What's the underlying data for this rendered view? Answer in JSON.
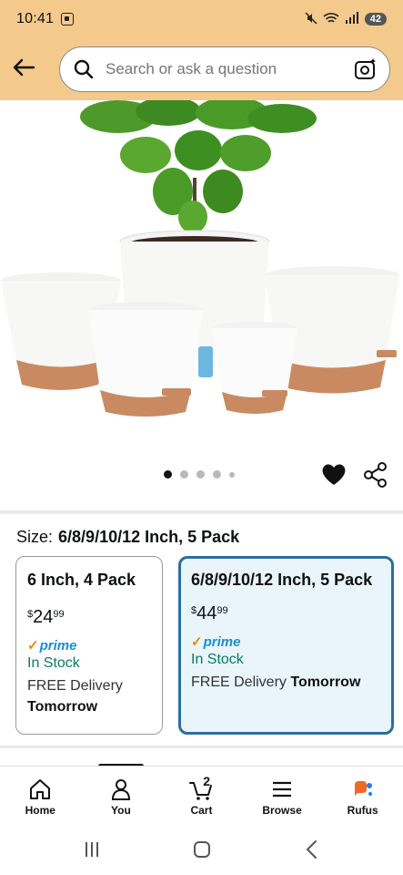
{
  "status_bar": {
    "time": "10:41",
    "battery": "42"
  },
  "search": {
    "placeholder": "Search or ask a question"
  },
  "product": {
    "image_alt": "Self-watering planters with fiddle leaf fig",
    "image_count": 5,
    "active_image": 0
  },
  "size_selector": {
    "label": "Size:",
    "selected_value": "6/8/9/10/12 Inch, 5 Pack",
    "options": [
      {
        "title": "6 Inch, 4 Pack",
        "price_symbol": "$",
        "price_whole": "24",
        "price_cents": "99",
        "prime": "prime",
        "stock": "In Stock",
        "delivery_prefix": "FREE Delivery",
        "delivery_day": "Tomorrow",
        "selected": false
      },
      {
        "title": "6/8/9/10/12 Inch, 5 Pack",
        "price_symbol": "$",
        "price_whole": "44",
        "price_cents": "99",
        "prime": "prime",
        "stock": "In Stock",
        "delivery_prefix": "FREE Delivery",
        "delivery_day": "Tomorrow",
        "selected": true
      }
    ]
  },
  "bottom_nav": {
    "items": [
      {
        "label": "Home",
        "icon": "home-icon"
      },
      {
        "label": "You",
        "icon": "person-icon"
      },
      {
        "label": "Cart",
        "icon": "cart-icon",
        "badge": "2"
      },
      {
        "label": "Browse",
        "icon": "menu-icon"
      },
      {
        "label": "Rufus",
        "icon": "rufus-icon"
      }
    ]
  },
  "colors": {
    "header_bg": "#f3c98c",
    "selected_border": "#2a6f9c",
    "selected_bg": "#eaf4fb",
    "stock_green": "#067d62",
    "prime_blue": "#1a8fd0",
    "prime_check": "#f08804"
  }
}
